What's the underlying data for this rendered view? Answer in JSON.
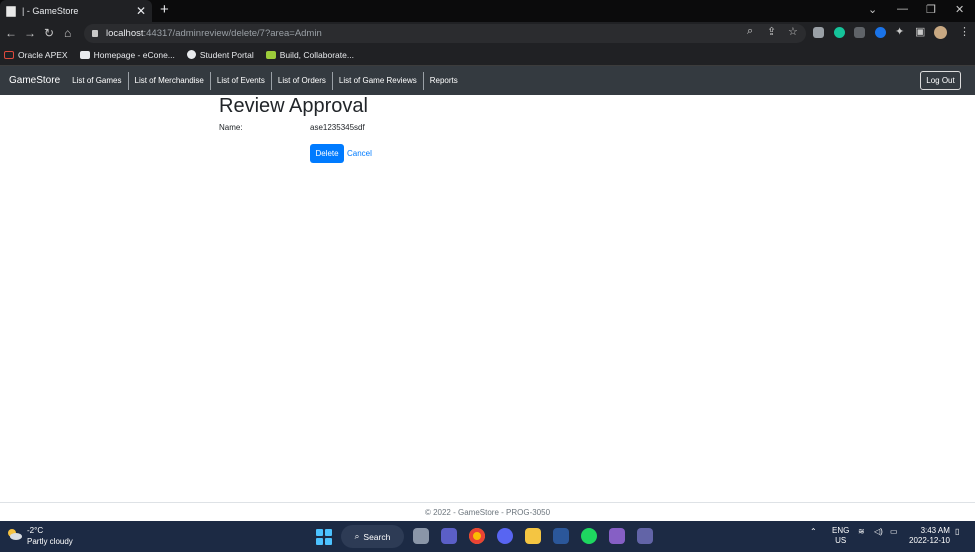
{
  "browser": {
    "tab_title": "| - GameStore",
    "url_host": "localhost",
    "url_rest": ":44317/adminreview/delete/7?area=Admin",
    "bookmarks": [
      {
        "label": "Oracle APEX"
      },
      {
        "label": "Homepage - eCone..."
      },
      {
        "label": "Student Portal"
      },
      {
        "label": "Build, Collaborate..."
      }
    ]
  },
  "navbar": {
    "brand": "GameStore",
    "links": [
      "List of Games",
      "List of Merchandise",
      "List of Events",
      "List of Orders",
      "List of Game Reviews",
      "Reports"
    ],
    "logout_label": "Log Out"
  },
  "main": {
    "title": "Review Approval",
    "fields": [
      {
        "label": "Name:",
        "value": "ase1235345sdf"
      }
    ],
    "delete_label": "Delete",
    "cancel_label": "Cancel"
  },
  "footer": {
    "text": "© 2022 - GameStore - PROG-3050"
  },
  "taskbar": {
    "weather_temp": "-2°C",
    "weather_desc": "Partly cloudy",
    "search_label": "Search",
    "lang_line1": "ENG",
    "lang_line2": "US",
    "time": "3:43 AM",
    "date": "2022-12-10"
  },
  "colors": {
    "navbar_bg": "#343a40",
    "primary": "#007bff",
    "taskbar_bg": "#1c2a44",
    "browser_chrome": "#202124"
  }
}
